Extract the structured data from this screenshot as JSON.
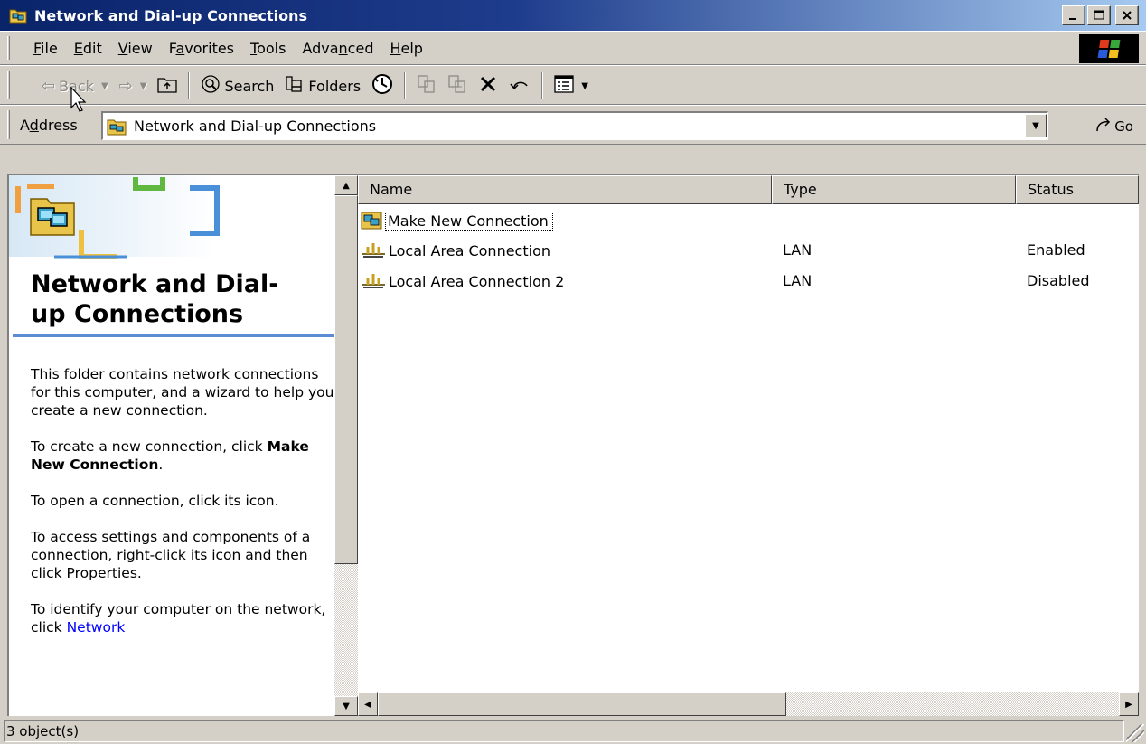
{
  "window": {
    "title": "Network and Dial-up Connections",
    "buttons": {
      "minimize": "_",
      "maximize": "□",
      "close": "×"
    }
  },
  "menu": {
    "items": [
      {
        "label": "File",
        "accel": "F"
      },
      {
        "label": "Edit",
        "accel": "E"
      },
      {
        "label": "View",
        "accel": "V"
      },
      {
        "label": "Favorites",
        "accel": "a"
      },
      {
        "label": "Tools",
        "accel": "T"
      },
      {
        "label": "Advanced",
        "accel": "n"
      },
      {
        "label": "Help",
        "accel": "H"
      }
    ]
  },
  "toolbar": {
    "back_label": "Back",
    "search_label": "Search",
    "folders_label": "Folders",
    "icons": [
      "back-icon",
      "forward-icon",
      "up-icon",
      "search-icon",
      "folders-icon",
      "history-icon",
      "move-to-icon",
      "copy-to-icon",
      "delete-icon",
      "undo-icon",
      "views-icon"
    ]
  },
  "address": {
    "label": "Address",
    "accel": "d",
    "value": "Network and Dial-up Connections",
    "go_label": "Go"
  },
  "left_pane": {
    "title_line1": "Network and Dial-",
    "title_line2": "up Connections",
    "p1": "This folder contains network connections for this computer, and a wizard to help you create a new connection.",
    "p2_text": "To create a new connection, click",
    "p2_bold": "Make New Connection",
    "p2_end": ".",
    "p3": "To open a connection, click its icon.",
    "p4": "To access settings and components of a connection, right-click its icon and then click Properties.",
    "p5_text": "To identify your computer on the network, click",
    "p5_link": "Network"
  },
  "list": {
    "columns": [
      "Name",
      "Type",
      "Status"
    ],
    "rows": [
      {
        "name": "Make New Connection",
        "type": "",
        "status": "",
        "icon": "make-new-connection-icon"
      },
      {
        "name": "Local Area Connection",
        "type": "LAN",
        "status": "Enabled",
        "icon": "lan-connection-icon"
      },
      {
        "name": "Local Area Connection 2",
        "type": "LAN",
        "status": "Disabled",
        "icon": "lan-connection-icon"
      }
    ]
  },
  "status_bar": {
    "text": "3 object(s)"
  },
  "colors": {
    "titlebar_start": "#0a246a",
    "titlebar_end": "#a6caf0",
    "face": "#d4d0c8",
    "link": "#0000ff",
    "pane_rule": "#5b8bd2"
  }
}
